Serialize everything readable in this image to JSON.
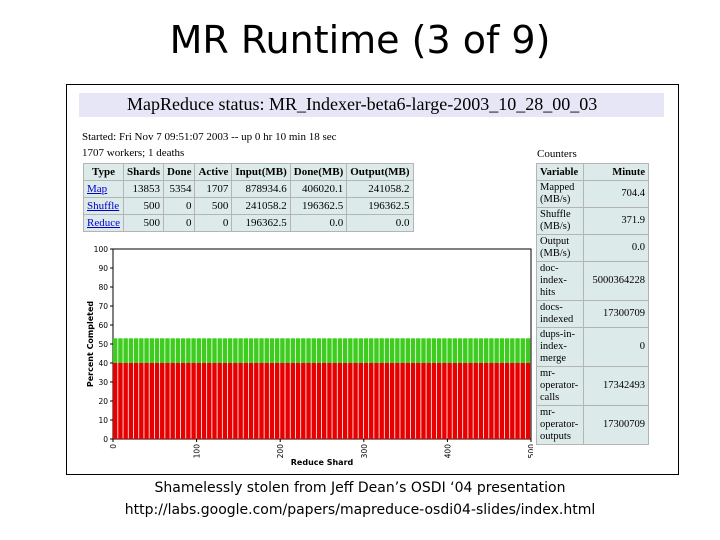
{
  "slide": {
    "title": "MR Runtime (3 of 9)",
    "caption_line1": "Shamelessly stolen from Jeff Dean’s OSDI ‘04 presentation",
    "caption_line2": "http://labs.google.com/papers/mapreduce-osdi04-slides/index.html"
  },
  "status": {
    "header": "MapReduce status: MR_Indexer-beta6-large-2003_10_28_00_03",
    "started": "Started: Fri Nov 7 09:51:07 2003 -- up 0 hr 10 min 18 sec",
    "workers": "1707 workers; 1 deaths"
  },
  "jobs_table": {
    "headers": [
      "Type",
      "Shards",
      "Done",
      "Active",
      "Input(MB)",
      "Done(MB)",
      "Output(MB)"
    ],
    "rows": [
      [
        "Map",
        "13853",
        "5354",
        "1707",
        "878934.6",
        "406020.1",
        "241058.2"
      ],
      [
        "Shuffle",
        "500",
        "0",
        "500",
        "241058.2",
        "196362.5",
        "196362.5"
      ],
      [
        "Reduce",
        "500",
        "0",
        "0",
        "196362.5",
        "0.0",
        "0.0"
      ]
    ]
  },
  "counters": {
    "label": "Counters",
    "headers": [
      "Variable",
      "Minute"
    ],
    "rows": [
      [
        "Mapped (MB/s)",
        "704.4"
      ],
      [
        "Shuffle (MB/s)",
        "371.9"
      ],
      [
        "Output (MB/s)",
        "0.0"
      ],
      [
        "doc-index-hits",
        "5000364228"
      ],
      [
        "docs-indexed",
        "17300709"
      ],
      [
        "dups-in-index-merge",
        "0"
      ],
      [
        "mr-operator-calls",
        "17342493"
      ],
      [
        "mr-operator-outputs",
        "17300709"
      ]
    ]
  },
  "chart_data": {
    "type": "bar",
    "xlabel": "Reduce Shard",
    "ylabel": "Percent Completed",
    "xlim": [
      0,
      500
    ],
    "ylim": [
      0,
      100
    ],
    "xticks": [
      0,
      100,
      200,
      300,
      400,
      500
    ],
    "yticks": [
      0,
      10,
      20,
      30,
      40,
      50,
      60,
      70,
      80,
      90,
      100
    ],
    "num_shards": 500,
    "series": [
      {
        "values_all_shards": 40,
        "color": "#e80000"
      },
      {
        "values_all_shards": 13,
        "color": "#3ecc1f"
      }
    ]
  }
}
